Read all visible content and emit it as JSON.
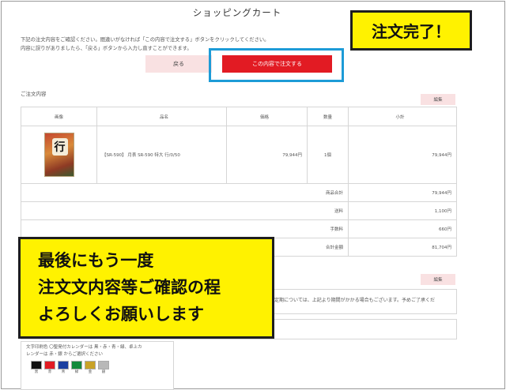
{
  "page": {
    "title": "ショッピングカート",
    "instructions": [
      "下記の注文内容をご確認ください。間違いがなければ「この内容で注文する」ボタンをクリックしてください。",
      "内容に誤りがありましたら、「戻る」ボタンから入力し直すことができます。"
    ],
    "back_label": "戻る",
    "order_label": "この内容で注文する"
  },
  "callouts": {
    "done": "注文完了！",
    "main_lines": [
      "最後にもう一度",
      "注文文内容等ご確認の程",
      "よろしくお願いします"
    ]
  },
  "order": {
    "section_label": "ご注文内容",
    "edit_label": "編集",
    "headers": [
      "画像",
      "品名",
      "価格",
      "数量",
      "小計"
    ],
    "item": {
      "name": "【SR-590】 月表 SR-590 特大 行/0/50",
      "price": "79,944円",
      "qty": "1個",
      "subtotal": "79,944円"
    },
    "summary": [
      {
        "label": "商品合計",
        "value": "79,944円"
      },
      {
        "label": "送料",
        "value": "1,100円"
      },
      {
        "label": "手数料",
        "value": "660円"
      },
      {
        "label": "合計金額",
        "value": "81,704円"
      }
    ]
  },
  "notes": {
    "edit_label": "編集",
    "text": "定期については、上記より期間がかかる場合もございます。予めご了承くだ"
  },
  "colors_panel": {
    "text_line1": "文字印刷色 〇聖発付カレンダーは 黒・赤・青・緑、卓上カ",
    "text_line2": "レンダーは 赤・銀 からご選択ください",
    "swatches": [
      {
        "color": "#111111",
        "label": "黒"
      },
      {
        "color": "#e21b23",
        "label": "赤"
      },
      {
        "color": "#1b3fa0",
        "label": "青"
      },
      {
        "color": "#138a3c",
        "label": "緑"
      },
      {
        "color": "#c9a227",
        "label": "金"
      },
      {
        "color": "#b8b8b8",
        "label": "銀"
      }
    ]
  }
}
